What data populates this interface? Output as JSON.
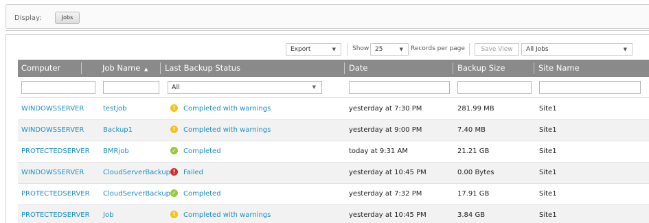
{
  "display": {
    "label": "Display:",
    "jobs_button": "Jobs"
  },
  "toolbar": {
    "export_label": "Export",
    "show_label": "Show",
    "show_value": "25",
    "records_label": "Records per page",
    "save_view_label": "Save View",
    "view_value": "All Jobs"
  },
  "table": {
    "columns": [
      "Computer",
      "Job Name",
      "Last Backup Status",
      "Date",
      "Backup Size",
      "Site Name"
    ],
    "sort_indicator": "▲",
    "status_filter": "All",
    "rows": [
      {
        "computer": "WINDOWSSERVER",
        "job": "testjob",
        "status": "Completed with warnings",
        "status_type": "warning",
        "date": "yesterday at 7:30 PM",
        "size": "281.99 MB",
        "site": "Site1"
      },
      {
        "computer": "WINDOWSSERVER",
        "job": "Backup1",
        "status": "Completed with warnings",
        "status_type": "warning",
        "date": "yesterday at 9:00 PM",
        "size": "7.40 MB",
        "site": "Site1"
      },
      {
        "computer": "PROTECTEDSERVER",
        "job": "BMRjob",
        "status": "Completed",
        "status_type": "ok",
        "date": "today at 9:31 AM",
        "size": "21.21 GB",
        "site": "Site1"
      },
      {
        "computer": "WINDOWSSERVER",
        "job": "CloudServerBackup",
        "status": "Failed",
        "status_type": "fail",
        "date": "yesterday at 10:45 PM",
        "size": "0.00 Bytes",
        "site": "Site1"
      },
      {
        "computer": "PROTECTEDSERVER",
        "job": "CloudServerBackup",
        "status": "Completed",
        "status_type": "ok",
        "date": "yesterday at 7:32 PM",
        "size": "17.91 GB",
        "site": "Site1"
      },
      {
        "computer": "PROTECTEDSERVER",
        "job": "Job",
        "status": "Completed with warnings",
        "status_type": "warning",
        "date": "yesterday at 10:45 PM",
        "size": "3.84 GB",
        "site": "Site1"
      }
    ]
  },
  "icons": {
    "warning": "warning-icon",
    "ok": "check-icon",
    "fail": "error-icon"
  },
  "colors": {
    "link": "#1a8fc7",
    "header_bg": "#8a8a8a",
    "warning": "#f3c21b",
    "ok": "#97c93d",
    "fail": "#c9302c"
  }
}
